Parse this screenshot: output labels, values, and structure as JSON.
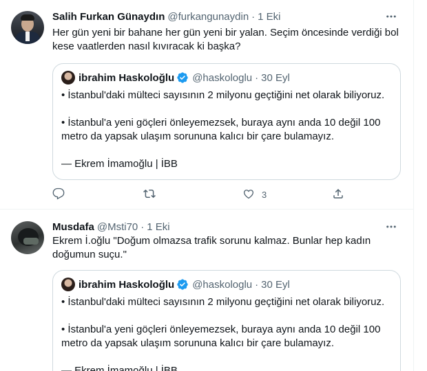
{
  "tweets": [
    {
      "author_name": "Salih Furkan Günaydın",
      "handle": "@furkangunaydin",
      "dot": "·",
      "date": "1 Eki",
      "text": "Her gün yeni bir bahane her gün yeni bir yalan. Seçim öncesinde verdiği bol kese vaatlerden nasıl kıvıracak ki başka?",
      "quote": {
        "author_name": "ibrahim Haskoloğlu",
        "handle": "@haskologlu",
        "dot": "·",
        "date": "30 Eyl",
        "line1": "• İstanbul'daki mülteci sayısının 2 milyonu geçtiğini net olarak biliyoruz.",
        "line2": "• İstanbul'a yeni göçleri önleyemezsek, buraya aynı anda 10 değil 100 metro da yapsak ulaşım sorununa kalıcı bir çare bulamayız.",
        "line3": "— Ekrem İmamoğlu | İBB"
      },
      "actions": {
        "like_count": "3"
      }
    },
    {
      "author_name": "Musdafa",
      "handle": "@Msti70",
      "dot": "·",
      "date": "1 Eki",
      "text": "Ekrem İ.oğlu \"Doğum olmazsa trafik sorunu kalmaz. Bunlar hep kadın doğumun suçu.\"",
      "quote": {
        "author_name": "ibrahim Haskoloğlu",
        "handle": "@haskologlu",
        "dot": "·",
        "date": "30 Eyl",
        "line1": "• İstanbul'daki mülteci sayısının 2 milyonu geçtiğini net olarak biliyoruz.",
        "line2": "• İstanbul'a yeni göçleri önleyemezsek, buraya aynı anda 10 değil 100 metro da yapsak ulaşım sorununa kalıcı bir çare bulamayız.",
        "line3": "— Ekrem İmamoğlu | İBB"
      }
    }
  ],
  "icons": {
    "more": "more-horizontal-icon",
    "verified": "verified-badge-icon",
    "reply": "reply-icon",
    "retweet": "retweet-icon",
    "like": "heart-icon",
    "share": "share-icon"
  },
  "colors": {
    "text_primary": "#0f1419",
    "text_secondary": "#536471",
    "border": "#cfd9de",
    "divider": "#eff3f4",
    "verified": "#1d9bf0"
  }
}
